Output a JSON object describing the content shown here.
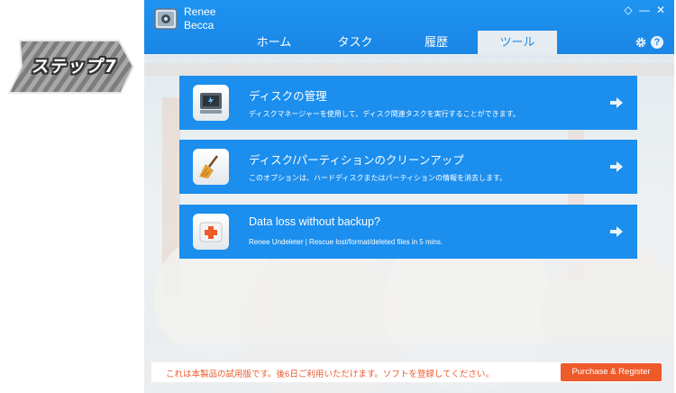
{
  "step_badge": {
    "label": "ステップ7"
  },
  "app": {
    "name_line1": "Renee",
    "name_line2": "Becca"
  },
  "window_controls": {
    "diamond": "◇",
    "minimize": "—",
    "close": "✕"
  },
  "tabs": [
    {
      "label": "ホーム",
      "active": false
    },
    {
      "label": "タスク",
      "active": false
    },
    {
      "label": "履歴",
      "active": false
    },
    {
      "label": "ツール",
      "active": true
    }
  ],
  "header_icons": {
    "settings": "gear-icon",
    "help": "?"
  },
  "tools": [
    {
      "title": "ディスクの管理",
      "description": "ディスクマネージャーを使用して、ディスク関連タスクを実行することができます。",
      "icon": "disk-icon"
    },
    {
      "title": "ディスク/パーティションのクリーンアップ",
      "description": "このオプションは、ハードディスクまたはパーティションの情報を消去します。",
      "icon": "broom-icon"
    },
    {
      "title": "Data loss without backup?",
      "description": "Renee Undeleter | Rescue lost/format/deleted files in 5 mins.",
      "icon": "medkit-icon"
    }
  ],
  "trial": {
    "message": "これは本製品の試用版です。後6日ご利用いただけます。ソフトを登録してください。",
    "purchase_label": "Purchase & Register"
  },
  "colors": {
    "accent": "#1b8eee",
    "titlebar": "#1e93f0",
    "purchase": "#ef5a2a",
    "trial_text": "#ea5a2d"
  }
}
